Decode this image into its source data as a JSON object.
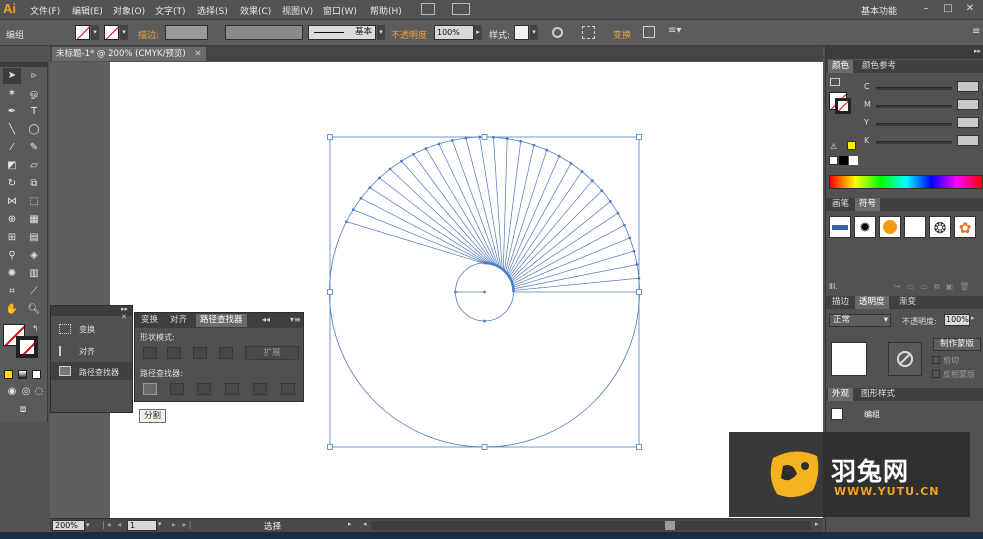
{
  "app": {
    "logo": "Ai",
    "workspace": "基本功能",
    "menu": [
      "文件(F)",
      "编辑(E)",
      "对象(O)",
      "文字(T)",
      "选择(S)",
      "效果(C)",
      "视图(V)",
      "窗口(W)",
      "帮助(H)"
    ]
  },
  "control_bar": {
    "selection_label": "编组",
    "stroke_label": "描边:",
    "stroke_style": "基本",
    "opacity_label": "不透明度",
    "opacity_value": "100%",
    "style_label": "样式:",
    "transform_label": "变换"
  },
  "document": {
    "tab_title": "未标题-1* @ 200% (CMYK/预览)"
  },
  "tools_panel": {
    "items": [
      "变换",
      "对齐",
      "路径查找器"
    ]
  },
  "pathfinder_panel": {
    "tabs": [
      "变换",
      "对齐",
      "路径查找器"
    ],
    "shape_modes_label": "形状模式:",
    "expand_label": "扩展",
    "pathfinders_label": "路径查找器:",
    "tooltip": "分割"
  },
  "color_panel": {
    "tabs": [
      "颜色",
      "颜色参考"
    ],
    "channels": [
      "C",
      "M",
      "Y",
      "K"
    ]
  },
  "brush_panel": {
    "tabs": [
      "画笔",
      "符号"
    ]
  },
  "transparency_panel": {
    "tabs": [
      "描边",
      "透明度",
      "渐变"
    ],
    "blend_mode": "正常",
    "opacity_label": "不透明度:",
    "opacity_value": "100%",
    "make_mask": "制作蒙版",
    "clip": "剪切",
    "invert_mask": "反相蒙版"
  },
  "appearance_panel": {
    "tabs": [
      "外观",
      "图形样式"
    ],
    "item": "编组"
  },
  "status_bar": {
    "zoom": "200%",
    "artboard": "1",
    "tool": "选择"
  },
  "watermark": {
    "brand": "羽兔网",
    "url": "WWW.YUTU.CN"
  },
  "colors": {
    "path_stroke": "#5577bb",
    "selection": "#4a7fc8",
    "accent": "#f2a13a"
  }
}
